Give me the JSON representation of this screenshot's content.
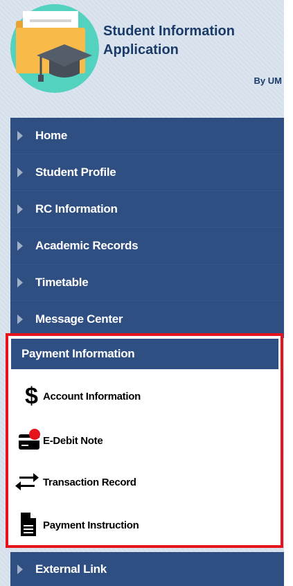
{
  "app": {
    "title": "Student Information Application",
    "byline": "By UM"
  },
  "nav": {
    "items": [
      {
        "label": "Home"
      },
      {
        "label": "Student Profile"
      },
      {
        "label": "RC Information"
      },
      {
        "label": "Academic Records"
      },
      {
        "label": "Timetable"
      },
      {
        "label": "Message Center"
      }
    ]
  },
  "payment": {
    "header": "Payment Information",
    "items": [
      {
        "label": "Account Information",
        "icon": "dollar-icon"
      },
      {
        "label": "E-Debit Note",
        "icon": "card-notification-icon"
      },
      {
        "label": "Transaction Record",
        "icon": "transfer-arrows-icon"
      },
      {
        "label": "Payment Instruction",
        "icon": "document-icon"
      }
    ]
  },
  "external": {
    "label": "External Link"
  },
  "colors": {
    "nav_bg": "#2f4f82",
    "highlight_border": "#e5141d",
    "notification_dot": "#e5141d"
  }
}
